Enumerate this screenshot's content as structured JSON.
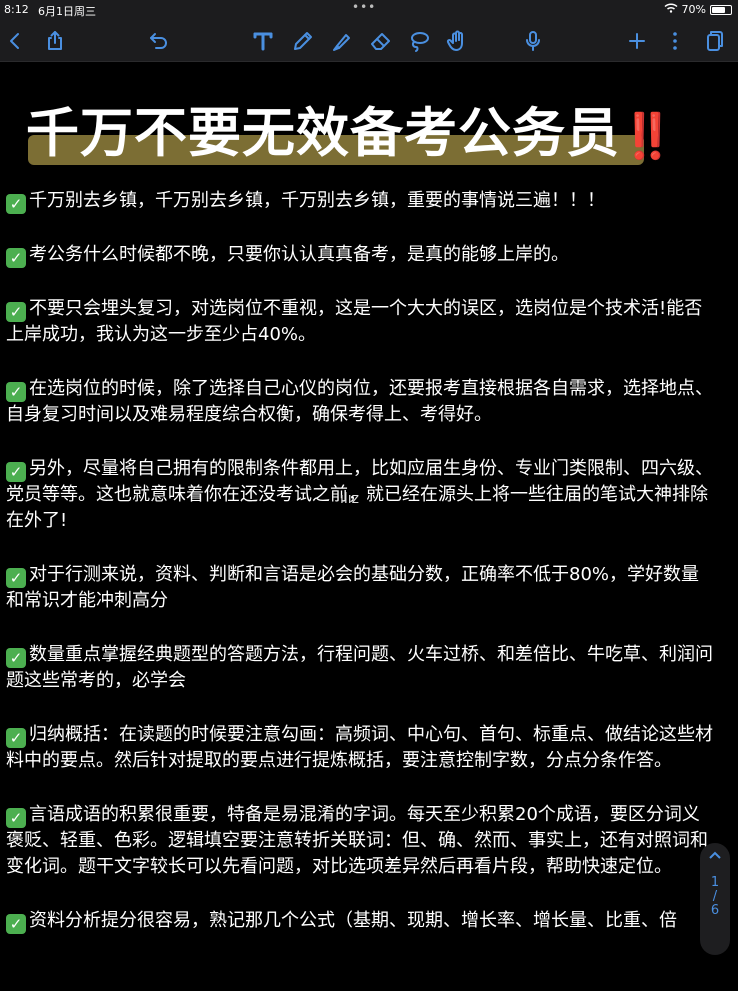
{
  "status_bar": {
    "time": "8:12",
    "date": "6月1日周三",
    "dots": "•••",
    "battery_text": "70%",
    "battery_level": 0.7
  },
  "toolbar": {
    "icons": [
      "back-chevron-icon",
      "share-icon",
      "undo-icon",
      "text-tool-icon",
      "pen-icon",
      "highlighter-icon",
      "eraser-icon",
      "lasso-icon",
      "hand-icon",
      "microphone-icon",
      "add-icon",
      "more-icon",
      "pages-icon"
    ]
  },
  "document": {
    "title": "千万不要无效备考公务员",
    "title_emoji": "‼️",
    "watermark": "ılız",
    "items": [
      "千万别去乡镇，千万别去乡镇，千万别去乡镇，重要的事情说三遍！！！",
      "考公务什么时候都不晚，只要你认认真真备考，是真的能够上岸的。",
      "不要只会埋头复习，对选岗位不重视，这是一个大大的误区，选岗位是个技术活!能否上岸成功，我认为这一步至少占40%。",
      "在选岗位的时候，除了选择自己心仪的岗位，还要报考直接根据各自需求，选择地点、自身复习时间以及难易程度综合权衡，确保考得上、考得好。",
      "另外，尽量将自己拥有的限制条件都用上，比如应届生身份、专业门类限制、四六级、党员等等。这也就意味着你在还没考试之前，就已经在源头上将一些往届的笔试大神排除在外了!",
      "对于行测来说，资料、判断和言语是必会的基础分数，正确率不低于80%，学好数量和常识才能冲刺高分",
      "数量重点掌握经典题型的答题方法，行程问题、火车过桥、和差倍比、牛吃草、利润问题这些常考的，必学会",
      "归纳概括：在读题的时候要注意勾画：高频词、中心句、首句、标重点、做结论这些材料中的要点。然后针对提取的要点进行提炼概括，要注意控制字数，分点分条作答。",
      "言语成语的积累很重要，特备是易混淆的字词。每天至少积累20个成语，要区分词义褒贬、轻重、色彩。逻辑填空要注意转折关联词：但、确、然而、事实上，还有对照词和变化词。题干文字较长可以先看问题，对比选项差异然后再看片段，帮助快速定位。",
      "资料分析提分很容易，熟记那几个公式（基期、现期、增长率、增长量、比重、倍"
    ],
    "check_glyph": "✓"
  },
  "page_indicator": {
    "current": "1",
    "separator": "/",
    "total": "6"
  },
  "colors": {
    "accent": "#4a8fe0",
    "check_green": "#4caf50",
    "title_highlight": "#8a7a3a",
    "emoji_red": "#e0262a"
  }
}
